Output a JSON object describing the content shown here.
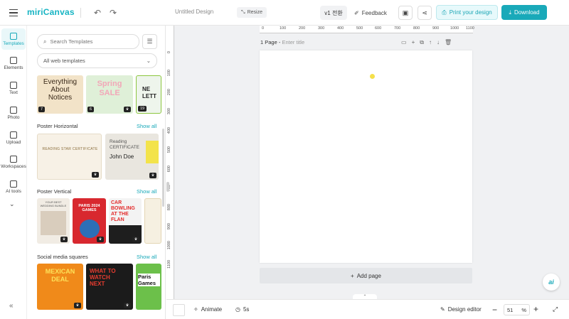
{
  "header": {
    "logo": "miriCanvas",
    "doc_title": "Untitled Design",
    "resize_label": "Resize",
    "version_label": "v1 전환",
    "feedback_label": "Feedback",
    "print_label": "Print your design",
    "download_label": "Download"
  },
  "rail": {
    "items": [
      {
        "label": "Templates"
      },
      {
        "label": "Elements"
      },
      {
        "label": "Text"
      },
      {
        "label": "Photo"
      },
      {
        "label": "Upload"
      },
      {
        "label": "Workspaces"
      },
      {
        "label": "AI tools"
      }
    ]
  },
  "panel": {
    "search_placeholder": "Search Templates",
    "filter_value": "All web templates",
    "top_row": [
      {
        "title": "Everything About Notices",
        "count": "7"
      },
      {
        "title": "Spring SALE",
        "count": "6"
      },
      {
        "title": "NE LETT",
        "count": "19"
      }
    ],
    "sections": [
      {
        "title": "Poster Horizontal",
        "show_all": "Show all",
        "items": [
          {
            "title": "READING STAR CERTIFICATE"
          },
          {
            "title": "Reading CERTIFICATE",
            "subtitle": "John Doe"
          }
        ]
      },
      {
        "title": "Poster Vertical",
        "show_all": "Show all",
        "items": [
          {
            "title": "YOUR BEST WEDDING BUNDLE"
          },
          {
            "title": "PARIS 2024 GAMES"
          },
          {
            "title": "CAR BOWLING AT THE FLAN"
          },
          {
            "title": ""
          }
        ]
      },
      {
        "title": "Social media squares",
        "show_all": "Show all",
        "items": [
          {
            "title": "MEXICAN DEAL"
          },
          {
            "title": "WHAT TO WATCH NEXT"
          },
          {
            "title": "Paris Games"
          }
        ]
      }
    ]
  },
  "canvas": {
    "ruler_top": [
      "100",
      "200",
      "300",
      "400",
      "500",
      "600",
      "700",
      "800",
      "900",
      "1000",
      "1100"
    ],
    "ruler_left": [
      "100",
      "200",
      "300",
      "400",
      "500",
      "600",
      "700",
      "800",
      "900",
      "1000",
      "1100"
    ],
    "page_label": "1 Page - ",
    "page_title_placeholder": "Enter title",
    "add_page_label": "Add page",
    "ai_label": "ai"
  },
  "footer": {
    "animate_label": "Animate",
    "duration_label": "5s",
    "design_editor_label": "Design editor",
    "zoom_value": "51",
    "zoom_unit": "%"
  },
  "colors": {
    "accent": "#19a9b9",
    "accent_light": "#e7f9fb"
  }
}
